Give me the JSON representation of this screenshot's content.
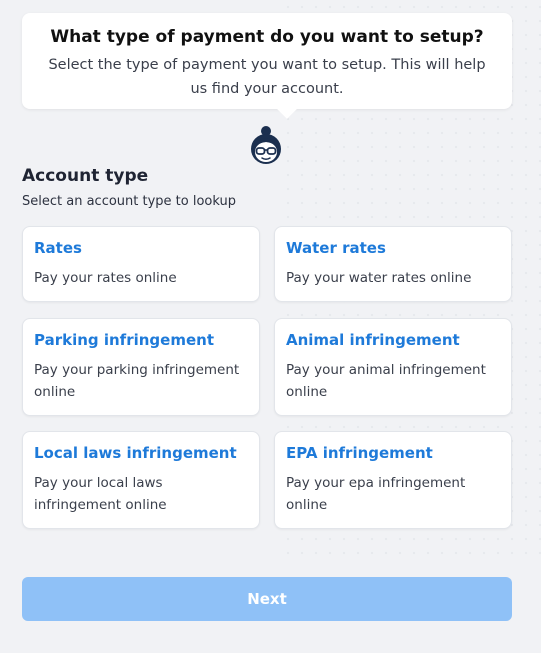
{
  "header": {
    "title": "What type of payment do you want to setup?",
    "subtitle": "Select the type of payment you want to setup. This will help us find your account."
  },
  "assistant": {
    "icon": "assistant-avatar-icon"
  },
  "section": {
    "title": "Account type",
    "subtitle": "Select an account type to lookup"
  },
  "options": [
    {
      "title": "Rates",
      "description": "Pay your rates online"
    },
    {
      "title": "Water rates",
      "description": "Pay your water rates online"
    },
    {
      "title": "Parking infringement",
      "description": "Pay your parking infringement online"
    },
    {
      "title": "Animal infringement",
      "description": "Pay your animal infringement online"
    },
    {
      "title": "Local laws infringement",
      "description": "Pay your local laws infringement online"
    },
    {
      "title": "EPA infringement",
      "description": "Pay your epa infringement online"
    }
  ],
  "actions": {
    "next_label": "Next"
  },
  "colors": {
    "accent": "#1e7ad9",
    "button_disabled": "#8fc1f7",
    "background": "#f1f2f5"
  }
}
